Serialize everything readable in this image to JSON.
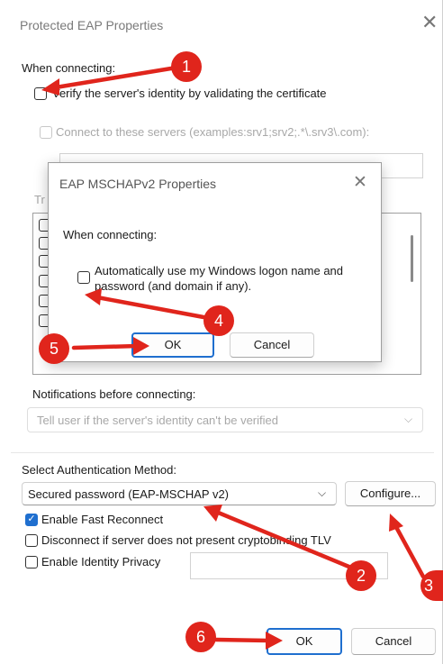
{
  "main_window": {
    "title": "Protected EAP Properties",
    "when_connecting": "When connecting:",
    "verify_label": "Verify the server's identity by validating the certificate",
    "connect_servers_label": "Connect to these servers (examples:srv1;srv2;.*\\.srv3\\.com):",
    "trusted_prefix": "Tr",
    "notifications_label": "Notifications before connecting:",
    "notifications_value": "Tell user if the server's identity can't be verified",
    "auth_method_label": "Select Authentication Method:",
    "auth_method_value": "Secured password (EAP-MSCHAP v2)",
    "configure_button": "Configure...",
    "fast_reconnect_label": "Enable Fast Reconnect",
    "disconnect_label": "Disconnect if server does not present cryptobinding TLV",
    "identity_privacy_label": "Enable Identity Privacy",
    "ok_button": "OK",
    "cancel_button": "Cancel"
  },
  "dialog": {
    "title": "EAP MSCHAPv2 Properties",
    "when_connecting": "When connecting:",
    "auto_logon_line1": "Automatically use my Windows logon name and",
    "auto_logon_line2": "password (and domain if any).",
    "ok_button": "OK",
    "cancel_button": "Cancel"
  },
  "annotations": {
    "badges": [
      "1",
      "2",
      "3",
      "4",
      "5",
      "6"
    ],
    "color": "#e0251c"
  },
  "colors": {
    "accent": "#1f6fcf"
  }
}
